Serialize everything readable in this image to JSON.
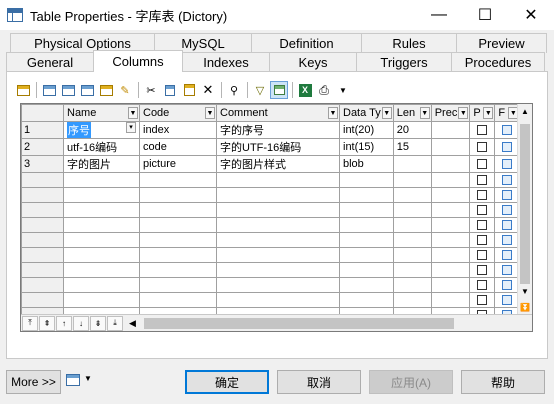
{
  "window": {
    "title": "Table Properties - 字库表 (Dictory)",
    "minimize_glyph": "—",
    "maximize_glyph": "☐",
    "close_glyph": "✕"
  },
  "tabs": {
    "row1": [
      "Physical Options",
      "MySQL",
      "Definition",
      "Rules",
      "Preview"
    ],
    "row2": [
      "General",
      "Columns",
      "Indexes",
      "Keys",
      "Triggers",
      "Procedures"
    ],
    "active": "Columns"
  },
  "toolbar": {
    "icons": [
      "properties-icon",
      "add-row-icon",
      "insert-row-icon",
      "add-rows-icon",
      "paste-rows-icon",
      "edit-icon",
      "cut-icon",
      "copy-icon",
      "paste-icon",
      "delete-icon",
      "find-icon",
      "filter-icon",
      "customize-columns-icon",
      "excel-export-icon",
      "print-icon"
    ]
  },
  "grid": {
    "headers": [
      "Name",
      "Code",
      "Comment",
      "Data Ty",
      "Len",
      "Prec",
      "P",
      "F"
    ],
    "rows": [
      {
        "num": "1",
        "name": "序号",
        "code": "index",
        "comment": "字的序号",
        "type": "int(20)",
        "len": "20",
        "prec": ""
      },
      {
        "num": "2",
        "name": "utf-16编码",
        "code": "code",
        "comment": "字的UTF-16编码",
        "type": "int(15)",
        "len": "15",
        "prec": ""
      },
      {
        "num": "3",
        "name": "字的图片",
        "code": "picture",
        "comment": "字的图片样式",
        "type": "blob",
        "len": "",
        "prec": ""
      }
    ]
  },
  "buttons": {
    "more": "More >>",
    "ok": "确定",
    "cancel": "取消",
    "apply": "应用(A)",
    "help": "帮助"
  }
}
